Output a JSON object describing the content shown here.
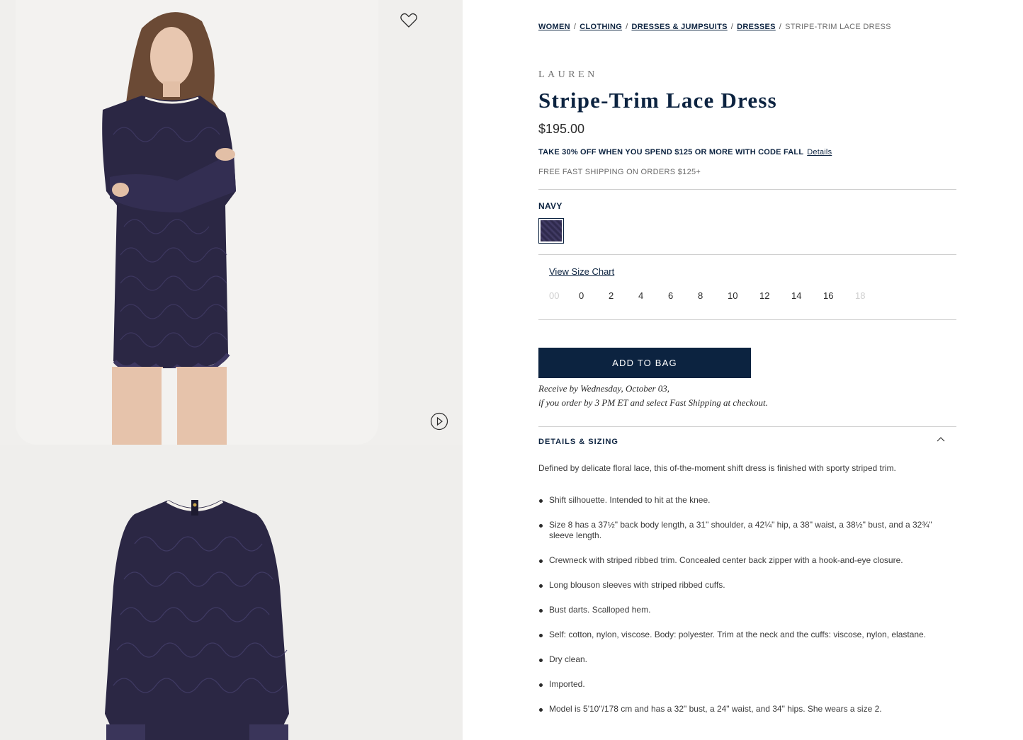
{
  "breadcrumb": {
    "links": [
      "WOMEN",
      "CLOTHING",
      "DRESSES & JUMPSUITS",
      "DRESSES"
    ],
    "current": "STRIPE-TRIM LACE DRESS"
  },
  "product": {
    "brand": "LAUREN",
    "title": "Stripe-Trim Lace Dress",
    "price": "$195.00",
    "promo": "TAKE 30% OFF WHEN YOU SPEND $125 OR MORE WITH CODE FALL",
    "promo_link": "Details",
    "shipping": "FREE FAST SHIPPING ON ORDERS $125+"
  },
  "color": {
    "selected": "NAVY",
    "swatch_color": "#2f2a4d"
  },
  "sizing": {
    "chart_link": "View Size Chart",
    "sizes": [
      {
        "label": "00",
        "available": false
      },
      {
        "label": "0",
        "available": true
      },
      {
        "label": "2",
        "available": true
      },
      {
        "label": "4",
        "available": true
      },
      {
        "label": "6",
        "available": true
      },
      {
        "label": "8",
        "available": true
      },
      {
        "label": "10",
        "available": true
      },
      {
        "label": "12",
        "available": true
      },
      {
        "label": "14",
        "available": true
      },
      {
        "label": "16",
        "available": true
      },
      {
        "label": "18",
        "available": false
      }
    ]
  },
  "cart": {
    "add_label": "ADD TO BAG",
    "delivery_line1": "Receive by Wednesday, October 03,",
    "delivery_line2": "if you order by 3 PM ET and select Fast Shipping at checkout."
  },
  "details": {
    "heading": "DETAILS & SIZING",
    "description": "Defined by delicate floral lace, this of-the-moment shift dress is finished with sporty striped trim.",
    "bullets": [
      "Shift silhouette. Intended to hit at the knee.",
      "Size 8 has a 37½\" back body length, a 31\" shoulder, a 42¼\" hip, a 38\" waist, a 38½\" bust, and a 32¾\" sleeve length.",
      "Crewneck with striped ribbed trim. Concealed center back zipper with a hook-and-eye closure.",
      "Long blouson sleeves with striped ribbed cuffs.",
      "Bust darts. Scalloped hem.",
      "Self: cotton, nylon, viscose. Body: polyester. Trim at the neck and the cuffs: viscose, nylon, elastane.",
      "Dry clean.",
      "Imported.",
      "Model is 5'10\"/178 cm and has a 32\" bust, a 24\" waist, and 34\" hips. She wears a size 2."
    ]
  },
  "icons": {
    "wishlist": "heart-icon",
    "video": "play-icon",
    "accordion": "chevron-up-icon"
  },
  "colors": {
    "brand_navy": "#0c2340",
    "gallery_bg": "#efeeec"
  }
}
